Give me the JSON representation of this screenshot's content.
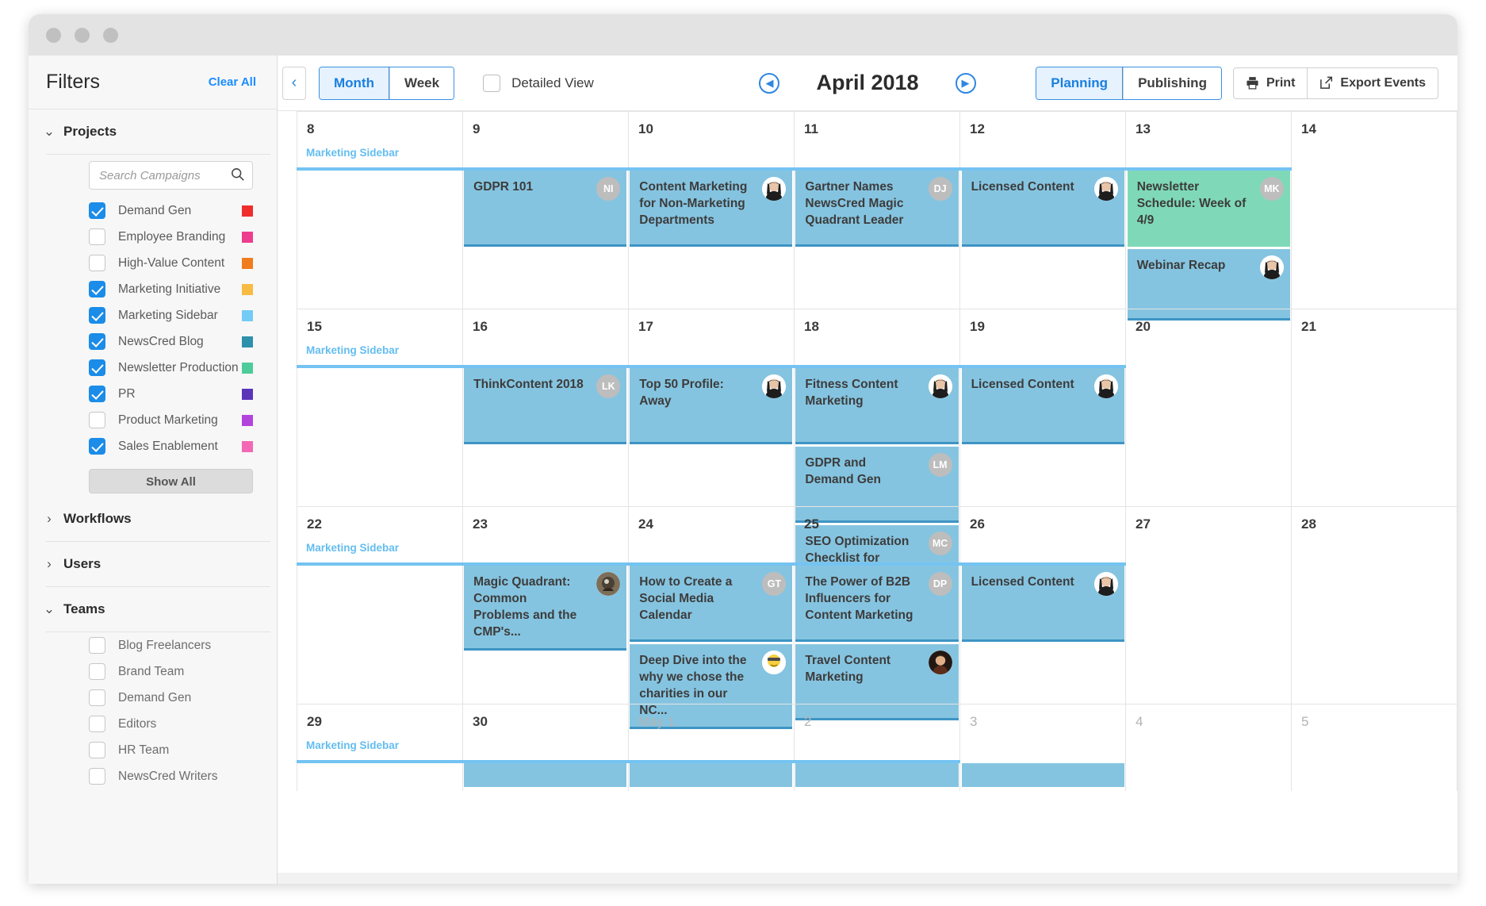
{
  "window": {
    "dots": 3
  },
  "sidebar": {
    "title": "Filters",
    "clear_all": "Clear All",
    "sections": [
      {
        "key": "projects",
        "label": "Projects",
        "expanded": true,
        "chevron": "chevron-down"
      },
      {
        "key": "workflows",
        "label": "Workflows",
        "expanded": false,
        "chevron": "chevron-right"
      },
      {
        "key": "users",
        "label": "Users",
        "expanded": false,
        "chevron": "chevron-right"
      },
      {
        "key": "teams",
        "label": "Teams",
        "expanded": true,
        "chevron": "chevron-down"
      }
    ],
    "search_placeholder": "Search Campaigns",
    "search_value": "",
    "projects": [
      {
        "label": "Demand Gen",
        "checked": true,
        "color": "#ef2d2d"
      },
      {
        "label": "Employee Branding",
        "checked": false,
        "color": "#ee3d8f"
      },
      {
        "label": "High-Value Content",
        "checked": false,
        "color": "#f07c1d"
      },
      {
        "label": "Marketing Initiative",
        "checked": true,
        "color": "#f7bb43"
      },
      {
        "label": "Marketing Sidebar",
        "checked": true,
        "color": "#74cbf5"
      },
      {
        "label": "NewsCred Blog",
        "checked": true,
        "color": "#2e91ab"
      },
      {
        "label": "Newsletter Production",
        "checked": true,
        "color": "#4ecb9a"
      },
      {
        "label": "PR",
        "checked": true,
        "color": "#5b35b8"
      },
      {
        "label": "Product Marketing",
        "checked": false,
        "color": "#b244dd"
      },
      {
        "label": "Sales Enablement",
        "checked": true,
        "color": "#f368b5"
      }
    ],
    "show_all": "Show All",
    "teams": [
      {
        "label": "Blog Freelancers",
        "checked": false
      },
      {
        "label": "Brand Team",
        "checked": false
      },
      {
        "label": "Demand Gen",
        "checked": false
      },
      {
        "label": "Editors",
        "checked": false
      },
      {
        "label": "HR Team",
        "checked": false
      },
      {
        "label": "NewsCred Writers",
        "checked": false
      }
    ]
  },
  "toolbar": {
    "back_icon": "chevron-left-icon",
    "view_modes": [
      {
        "label": "Month",
        "active": true
      },
      {
        "label": "Week",
        "active": false
      }
    ],
    "detailed_view": {
      "label": "Detailed View",
      "checked": false
    },
    "prev_icon": "circle-prev-icon",
    "next_icon": "circle-next-icon",
    "month_label": "April 2018",
    "mode_tabs": [
      {
        "label": "Planning",
        "active": true
      },
      {
        "label": "Publishing",
        "active": false
      }
    ],
    "print_label": "Print",
    "print_icon": "printer-icon",
    "export_label": "Export Events",
    "export_icon": "external-link-icon"
  },
  "calendar": {
    "allday_label": "Marketing Sidebar",
    "weeks": [
      {
        "days": [
          {
            "num": "8",
            "muted": false
          },
          {
            "num": "9",
            "muted": false
          },
          {
            "num": "10",
            "muted": false
          },
          {
            "num": "11",
            "muted": false
          },
          {
            "num": "12",
            "muted": false
          },
          {
            "num": "13",
            "muted": false
          },
          {
            "num": "14",
            "muted": false
          }
        ],
        "allday_span": 6,
        "events": [
          [],
          [
            {
              "title": "GDPR 101",
              "color": "blue",
              "avatar": "NI",
              "avatar_type": "initials",
              "size": "tall"
            }
          ],
          [
            {
              "title": "Content Marketing for Non-Marketing Departments",
              "color": "blue",
              "avatar": "photo-woman",
              "avatar_type": "photo",
              "size": "tall"
            }
          ],
          [
            {
              "title": "Gartner Names NewsCred Magic Quadrant Leader",
              "color": "blue",
              "avatar": "DJ",
              "avatar_type": "initials",
              "size": "tall"
            }
          ],
          [
            {
              "title": "Licensed Content",
              "color": "blue",
              "avatar": "photo-woman",
              "avatar_type": "photo",
              "size": "tall"
            }
          ],
          [
            {
              "title": "Newsletter Schedule: Week of 4/9",
              "color": "green",
              "avatar": "MK",
              "avatar_type": "initials",
              "size": "tall"
            },
            {
              "title": "Webinar Recap",
              "color": "blue",
              "avatar": "photo-woman",
              "avatar_type": "photo",
              "size": "tall2"
            }
          ],
          []
        ]
      },
      {
        "days": [
          {
            "num": "15",
            "muted": false
          },
          {
            "num": "16",
            "muted": false
          },
          {
            "num": "17",
            "muted": false
          },
          {
            "num": "18",
            "muted": false
          },
          {
            "num": "19",
            "muted": false
          },
          {
            "num": "20",
            "muted": false
          },
          {
            "num": "21",
            "muted": false
          }
        ],
        "allday_span": 5,
        "events": [
          [],
          [
            {
              "title": "ThinkContent 2018",
              "color": "blue",
              "avatar": "LK",
              "avatar_type": "initials",
              "size": "tall"
            }
          ],
          [
            {
              "title": "Top 50 Profile: Away",
              "color": "blue",
              "avatar": "photo-woman",
              "avatar_type": "photo",
              "size": "tall"
            }
          ],
          [
            {
              "title": "Fitness Content Marketing",
              "color": "blue",
              "avatar": "photo-woman",
              "avatar_type": "photo",
              "size": "tall"
            },
            {
              "title": "GDPR and Demand Gen",
              "color": "blue",
              "avatar": "LM",
              "avatar_type": "initials",
              "size": "tall"
            },
            {
              "title": "SEO Optimization Checklist for Content Marketers",
              "color": "blue",
              "avatar": "MC",
              "avatar_type": "initials",
              "size": "tall"
            }
          ],
          [
            {
              "title": "Licensed Content",
              "color": "blue",
              "avatar": "photo-woman",
              "avatar_type": "photo",
              "size": "tall"
            }
          ],
          [],
          []
        ]
      },
      {
        "days": [
          {
            "num": "22",
            "muted": false
          },
          {
            "num": "23",
            "muted": false
          },
          {
            "num": "24",
            "muted": false
          },
          {
            "num": "25",
            "muted": false
          },
          {
            "num": "26",
            "muted": false
          },
          {
            "num": "27",
            "muted": false
          },
          {
            "num": "28",
            "muted": false
          }
        ],
        "allday_span": 5,
        "events": [
          [],
          [
            {
              "title": "Magic Quadrant: Common Problems and the CMP's...",
              "color": "blue",
              "avatar": "photo-dark",
              "avatar_type": "photo",
              "size": "tall"
            }
          ],
          [
            {
              "title": "How to Create a Social Media Calendar",
              "color": "blue",
              "avatar": "GT",
              "avatar_type": "initials",
              "size": "tall"
            },
            {
              "title": "Deep Dive into the why we chose the charities in our NC...",
              "color": "blue",
              "avatar": "photo-emoji",
              "avatar_type": "photo",
              "size": "tall"
            }
          ],
          [
            {
              "title": "The Power of B2B Influencers for Content Marketing",
              "color": "blue",
              "avatar": "DP",
              "avatar_type": "initials",
              "size": "tall"
            },
            {
              "title": "Travel Content Marketing",
              "color": "blue",
              "avatar": "photo-woman2",
              "avatar_type": "photo",
              "size": "tall"
            }
          ],
          [
            {
              "title": "Licensed Content",
              "color": "blue",
              "avatar": "photo-woman",
              "avatar_type": "photo",
              "size": "tall"
            }
          ],
          [],
          []
        ]
      },
      {
        "days": [
          {
            "num": "29",
            "muted": false
          },
          {
            "num": "30",
            "muted": false
          },
          {
            "num": "May 1",
            "muted": true
          },
          {
            "num": "2",
            "muted": true
          },
          {
            "num": "3",
            "muted": true
          },
          {
            "num": "4",
            "muted": true
          },
          {
            "num": "5",
            "muted": true
          }
        ],
        "allday_span": 4,
        "events": [
          [],
          [
            {
              "title": "",
              "color": "blue",
              "avatar": "",
              "avatar_type": "none",
              "size": "cut"
            }
          ],
          [
            {
              "title": "",
              "color": "blue",
              "avatar": "",
              "avatar_type": "none",
              "size": "cut"
            }
          ],
          [
            {
              "title": "",
              "color": "blue",
              "avatar": "",
              "avatar_type": "none",
              "size": "cut"
            }
          ],
          [
            {
              "title": "",
              "color": "blue",
              "avatar": "",
              "avatar_type": "none",
              "size": "cut"
            }
          ],
          [],
          []
        ]
      }
    ]
  },
  "colors": {
    "accent": "#1a8cff",
    "event_blue": "#85c4e0",
    "event_blue_border": "#3e94c4",
    "event_green": "#7fd9b9",
    "allday_bar": "#74c3f2",
    "allday_text": "#63bdf0"
  }
}
